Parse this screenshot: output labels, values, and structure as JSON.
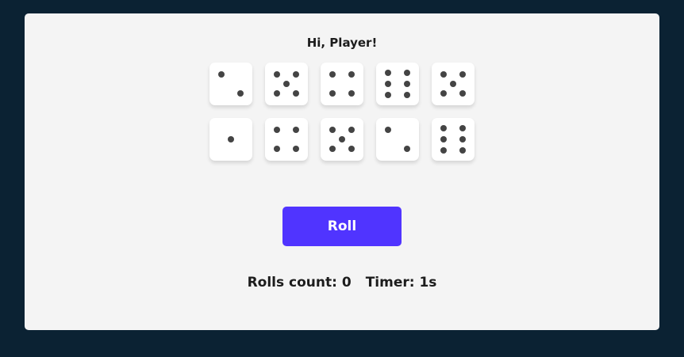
{
  "greeting": "Hi, Player!",
  "dice": [
    {
      "value": 2,
      "held": false
    },
    {
      "value": 5,
      "held": false
    },
    {
      "value": 4,
      "held": false
    },
    {
      "value": 6,
      "held": false
    },
    {
      "value": 5,
      "held": false
    },
    {
      "value": 1,
      "held": false
    },
    {
      "value": 4,
      "held": false
    },
    {
      "value": 5,
      "held": false
    },
    {
      "value": 2,
      "held": false
    },
    {
      "value": 6,
      "held": false
    }
  ],
  "roll_button": {
    "label": "Roll"
  },
  "stats": {
    "rolls_label": "Rolls count: ",
    "rolls_count": "0",
    "timer_label": "Timer: ",
    "timer_value": "1s"
  },
  "colors": {
    "background": "#0b2233",
    "card": "#f4f4f4",
    "accent": "#5034ff",
    "pip": "#444444"
  }
}
